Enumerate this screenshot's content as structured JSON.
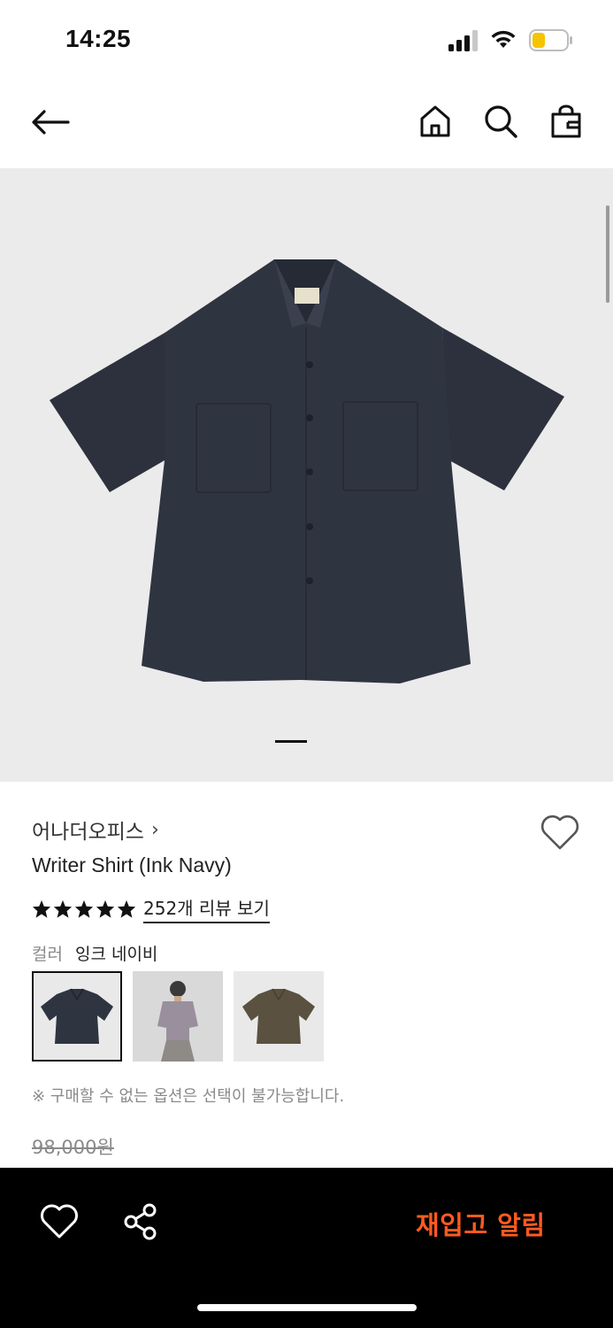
{
  "status_bar": {
    "time": "14:25",
    "icons": [
      "cellular-signal-icon",
      "wifi-icon",
      "battery-icon"
    ],
    "battery_color": "#f5c400"
  },
  "header": {
    "icons": [
      "back-arrow-icon",
      "home-icon",
      "search-icon",
      "shopping-bag-icon"
    ]
  },
  "hero": {
    "background": "#ebebeb",
    "shirt_color": "#2f3441",
    "image_label": "Writer Shirt Ink Navy product photo",
    "page_indicator": {
      "current": 1
    }
  },
  "product": {
    "brand": "어나더오피스",
    "brand_chevron": "›",
    "title": "Writer Shirt (Ink Navy)",
    "rating": 5,
    "review_link": "252개 리뷰 보기",
    "color_label": "컬러",
    "color_value": "잉크 네이비",
    "swatches": [
      {
        "name": "ink-navy",
        "color": "#2f3441",
        "selected": true
      },
      {
        "name": "model-lavender",
        "color": "#9a8f9c",
        "selected": false
      },
      {
        "name": "olive-brown",
        "color": "#5a5140",
        "selected": false
      }
    ],
    "notice": "※ 구매할 수 없는 옵션은 선택이 불가능합니다.",
    "original_price": "98,000원"
  },
  "bottom_bar": {
    "restock_label": "재입고 알림",
    "accent_color": "#ff5a1f",
    "icons": [
      "heart-icon",
      "share-icon"
    ]
  }
}
